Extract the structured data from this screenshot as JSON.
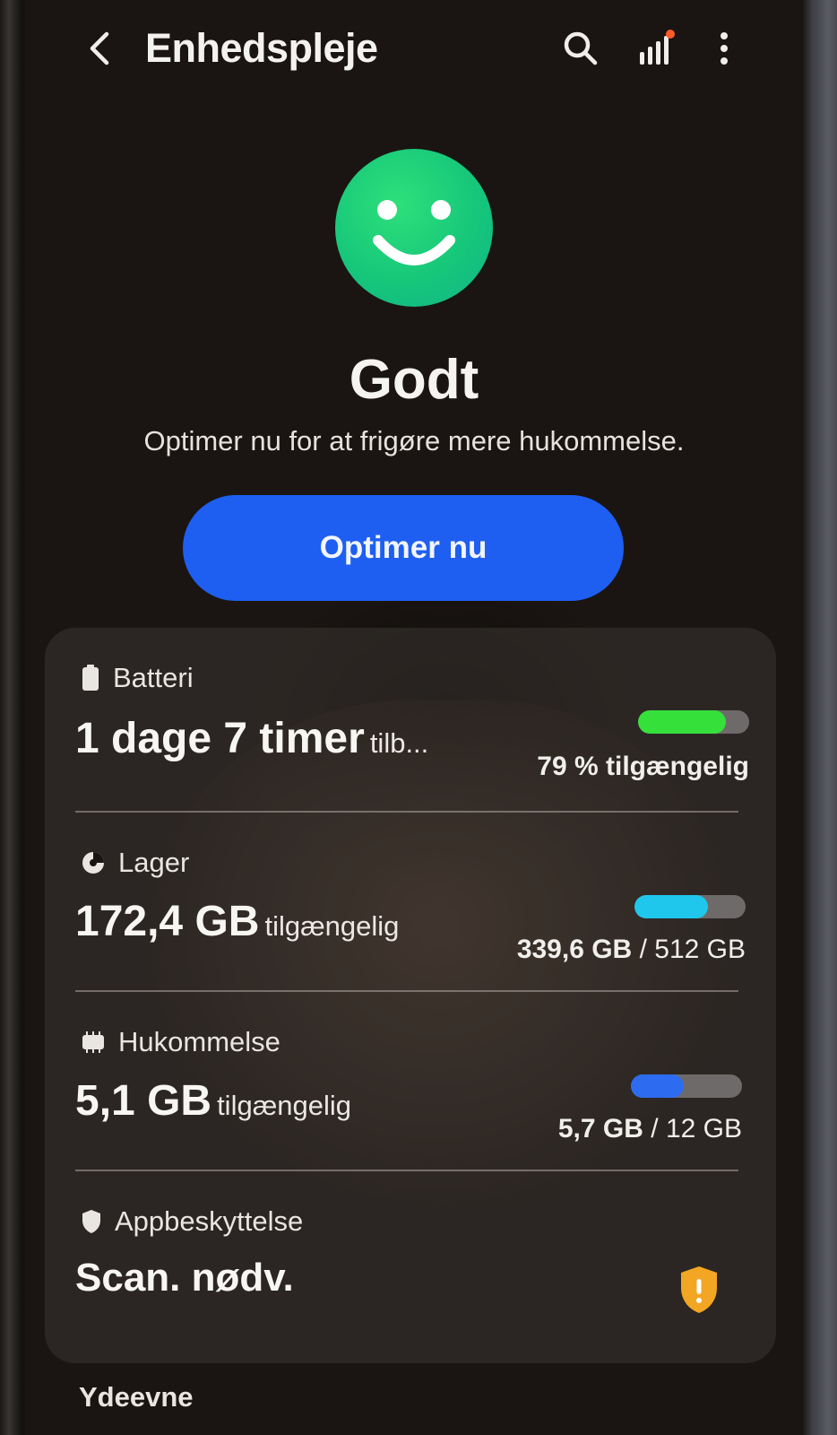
{
  "header": {
    "title": "Enhedspleje"
  },
  "status": {
    "title": "Godt",
    "subtitle": "Optimer nu for at frigøre mere hukommelse.",
    "color": "#16c77a"
  },
  "optimize_button": {
    "label": "Optimer nu",
    "color": "#1e5ff2"
  },
  "battery": {
    "label": "Batteri",
    "value": "1 dage 7 timer",
    "value_suffix": "tilb...",
    "right_text": "79 % tilgængelig",
    "level_fraction": 0.79,
    "bar_color": "#35e03b"
  },
  "storage": {
    "label": "Lager",
    "value": "172,4 GB",
    "value_suffix": "tilgængelig",
    "used": "339,6 GB",
    "separator": "/",
    "total": "512 GB",
    "used_fraction": 0.66,
    "bar_color": "#1fc7ec"
  },
  "memory": {
    "label": "Hukommelse",
    "value": "5,1 GB",
    "value_suffix": "tilgængelig",
    "used": "5,7 GB",
    "separator": "/",
    "total": "12 GB",
    "used_fraction": 0.475,
    "bar_color": "#2d6cf0"
  },
  "app_protection": {
    "label": "Appbeskyttelse",
    "value": "Scan. nødv.",
    "badge_icon": "warning-shield-icon",
    "badge_color": "#f3a623"
  },
  "more_section": {
    "title": "Ydeevne"
  }
}
